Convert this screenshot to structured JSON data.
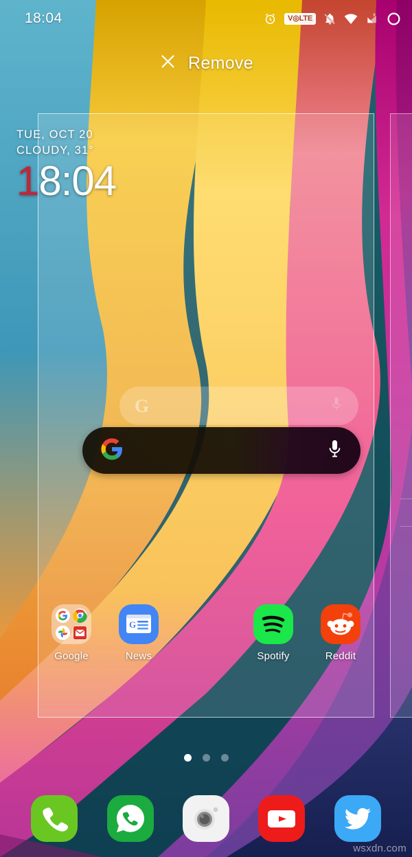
{
  "status_bar": {
    "time": "18:04",
    "icons": [
      {
        "name": "alarm-icon",
        "label": "alarm"
      },
      {
        "name": "volte-icon",
        "label": "VoLTE"
      },
      {
        "name": "notifications-muted-icon",
        "label": "ringer muted"
      },
      {
        "name": "wifi-icon",
        "label": "wifi"
      },
      {
        "name": "mobile-signal-off-icon",
        "label": "no mobile signal"
      },
      {
        "name": "battery-circle-icon",
        "label": "battery"
      }
    ]
  },
  "edit_mode": {
    "remove_label": "Remove",
    "remove_icon": "close-x-icon"
  },
  "widget": {
    "date": "TUE, OCT 20",
    "weather": "CLOUDY, 31°",
    "clock_accent": "1",
    "clock_rest": "8:04",
    "accent_color": "#c2253a"
  },
  "search": {
    "ghost_placeholder": "",
    "google_icon": "google-g-icon",
    "mic_icon": "microphone-icon",
    "dragged": true
  },
  "apps": [
    {
      "label": "Google",
      "icon": "google-folder-icon",
      "type": "folder",
      "contents": [
        "google-g-icon",
        "chrome-icon",
        "photos-icon",
        "gmail-icon"
      ]
    },
    {
      "label": "News",
      "icon": "google-news-icon",
      "type": "app"
    },
    {
      "label": "",
      "icon": "empty-slot",
      "type": "empty"
    },
    {
      "label": "Spotify",
      "icon": "spotify-icon",
      "type": "app"
    },
    {
      "label": "Reddit",
      "icon": "reddit-icon",
      "type": "app"
    }
  ],
  "page_indicator": {
    "count": 3,
    "active_index": 0
  },
  "dock": [
    {
      "label": "Phone",
      "icon": "phone-icon",
      "color": "#6ac721"
    },
    {
      "label": "WhatsApp",
      "icon": "whatsapp-icon",
      "color": "#1bab3f"
    },
    {
      "label": "Camera",
      "icon": "camera-icon",
      "color": "#f0f0f0"
    },
    {
      "label": "YouTube",
      "icon": "youtube-icon",
      "color": "#ee1b1b"
    },
    {
      "label": "Twitter",
      "icon": "twitter-icon",
      "color": "#3ba9f5"
    }
  ],
  "watermark": "wsxdn.com",
  "wallpaper": {
    "colors": [
      "#14525c",
      "#3e97b8",
      "#d9a300",
      "#f9c93d",
      "#ffd85c",
      "#f07f8c",
      "#ef4a8a",
      "#c2118b",
      "#8e3fa8",
      "#4a3a8f",
      "#1f2a5e"
    ]
  }
}
